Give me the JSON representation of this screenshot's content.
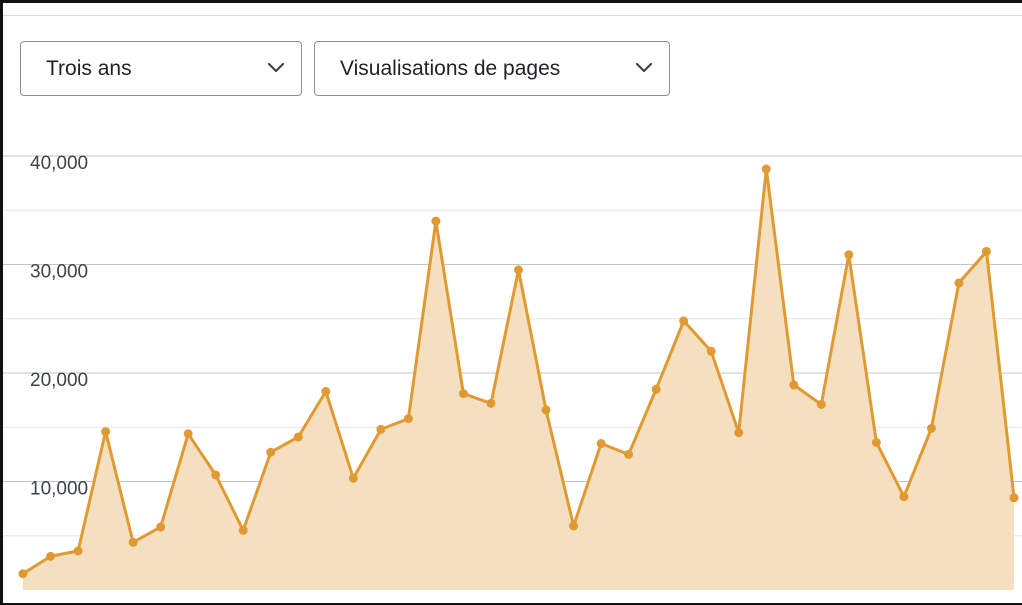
{
  "controls": {
    "period_select": {
      "value": "Trois ans",
      "icon": "chevron-down-icon"
    },
    "metric_select": {
      "value": "Visualisations de pages",
      "icon": "chevron-down-icon"
    }
  },
  "chart_data": {
    "type": "area",
    "title": "",
    "xlabel": "",
    "ylabel": "",
    "ylim": [
      0,
      44000
    ],
    "yticks": [
      10000,
      20000,
      30000,
      40000
    ],
    "ytick_labels": [
      "10,000",
      "20,000",
      "30,000",
      "40,000"
    ],
    "grid": true,
    "series": [
      {
        "values": [
          1500,
          3100,
          3600,
          14600,
          4400,
          5800,
          14400,
          10600,
          5500,
          12700,
          14100,
          18300,
          10300,
          14800,
          15800,
          34000,
          18100,
          17200,
          29500,
          16600,
          5900,
          13500,
          12500,
          18500,
          24800,
          22000,
          14500,
          38800,
          18900,
          17100,
          30900,
          13600,
          8600,
          14900,
          28300,
          31200,
          8500
        ],
        "color": "#e09a32",
        "fill": "#f5dfc1"
      }
    ]
  }
}
